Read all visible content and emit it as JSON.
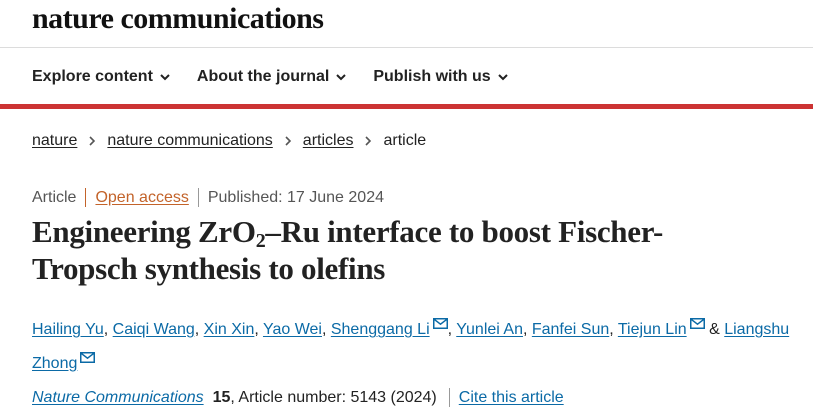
{
  "header": {
    "logo": "nature communications"
  },
  "nav": [
    {
      "label": "Explore content"
    },
    {
      "label": "About the journal"
    },
    {
      "label": "Publish with us"
    }
  ],
  "breadcrumb": [
    {
      "label": "nature"
    },
    {
      "label": "nature communications"
    },
    {
      "label": "articles"
    },
    {
      "label": "article"
    }
  ],
  "meta": {
    "type": "Article",
    "access": "Open access",
    "published": "Published: 17 June 2024"
  },
  "title": {
    "part1": "Engineering ZrO",
    "subscript": "2",
    "part2": "–Ru interface to boost Fischer-Tropsch synthesis to olefins"
  },
  "authors": [
    {
      "name": "Hailing Yu",
      "corresponding": false
    },
    {
      "name": "Caiqi Wang",
      "corresponding": false
    },
    {
      "name": "Xin Xin",
      "corresponding": false
    },
    {
      "name": "Yao Wei",
      "corresponding": false
    },
    {
      "name": "Shenggang Li",
      "corresponding": true
    },
    {
      "name": "Yunlei An",
      "corresponding": false
    },
    {
      "name": "Fanfei Sun",
      "corresponding": false
    },
    {
      "name": "Tiejun Lin",
      "corresponding": true
    },
    {
      "name": "Liangshu Zhong",
      "corresponding": true
    }
  ],
  "authors_final_joiner": "&",
  "citation": {
    "journal": "Nature Communications",
    "volume": "15",
    "rest": ", Article number: 5143 (2024)",
    "cite_label": "Cite this article"
  },
  "colors": {
    "accent_red": "#cc3333",
    "link_blue": "#0b6aa6",
    "open_access_orange": "#c3632a"
  }
}
